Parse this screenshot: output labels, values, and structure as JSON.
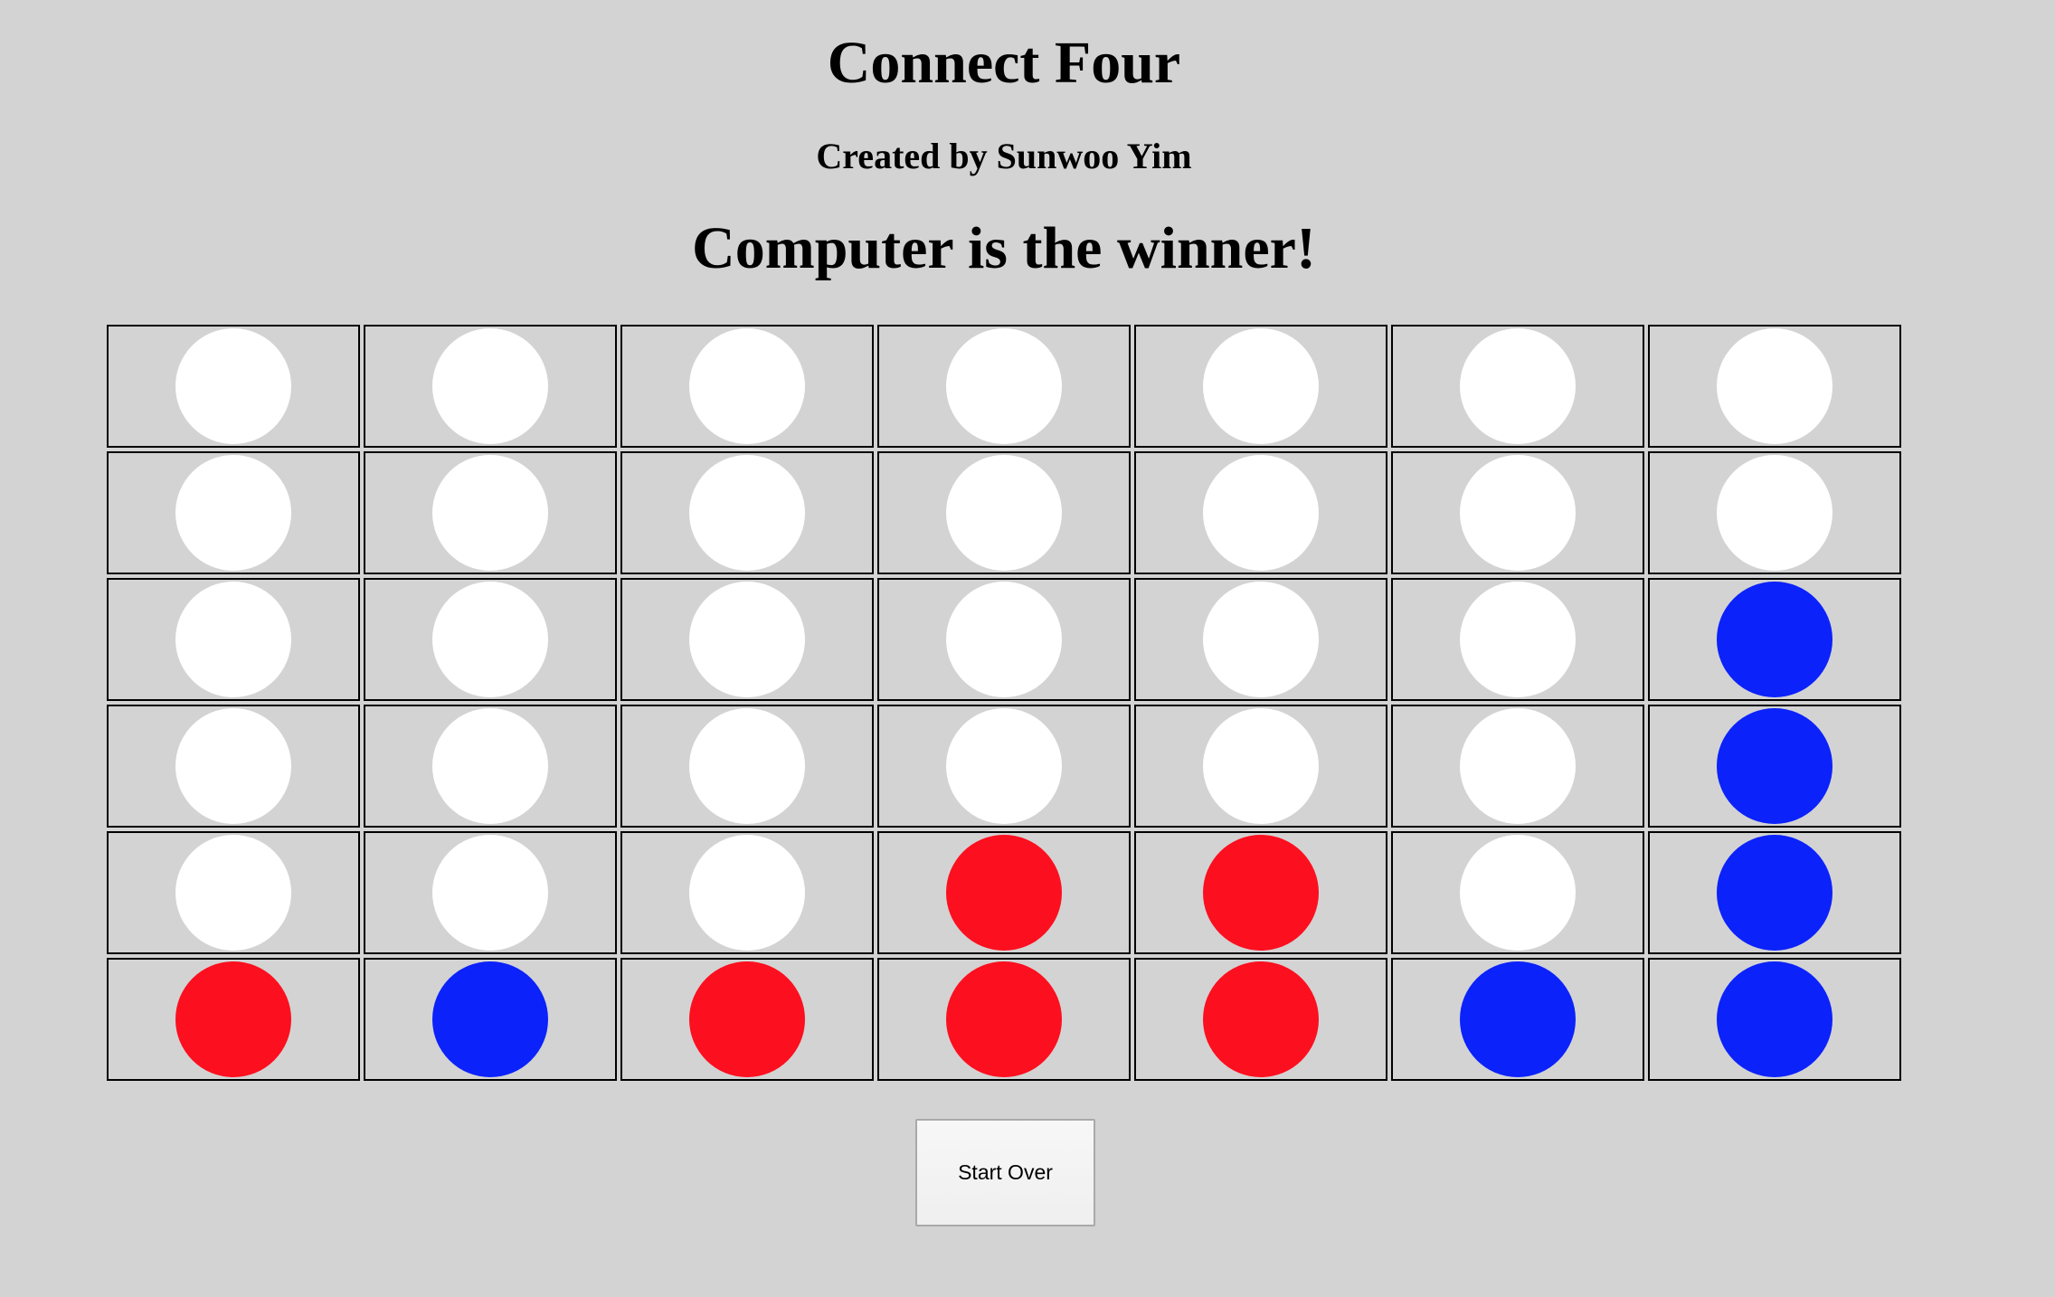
{
  "header": {
    "title": "Connect Four",
    "subtitle": "Created by Sunwoo Yim",
    "status": "Computer is the winner!"
  },
  "board": {
    "rows": 6,
    "columns": 7,
    "cells": [
      [
        "empty",
        "empty",
        "empty",
        "empty",
        "empty",
        "empty",
        "empty"
      ],
      [
        "empty",
        "empty",
        "empty",
        "empty",
        "empty",
        "empty",
        "empty"
      ],
      [
        "empty",
        "empty",
        "empty",
        "empty",
        "empty",
        "empty",
        "blue"
      ],
      [
        "empty",
        "empty",
        "empty",
        "empty",
        "empty",
        "empty",
        "blue"
      ],
      [
        "empty",
        "empty",
        "empty",
        "red",
        "red",
        "empty",
        "blue"
      ],
      [
        "red",
        "blue",
        "red",
        "red",
        "red",
        "blue",
        "blue"
      ]
    ]
  },
  "colors": {
    "background": "#d3d3d3",
    "empty": "#ffffff",
    "red": "#fc0f1f",
    "blue": "#0b22fa"
  },
  "controls": {
    "start_over_label": "Start Over"
  }
}
